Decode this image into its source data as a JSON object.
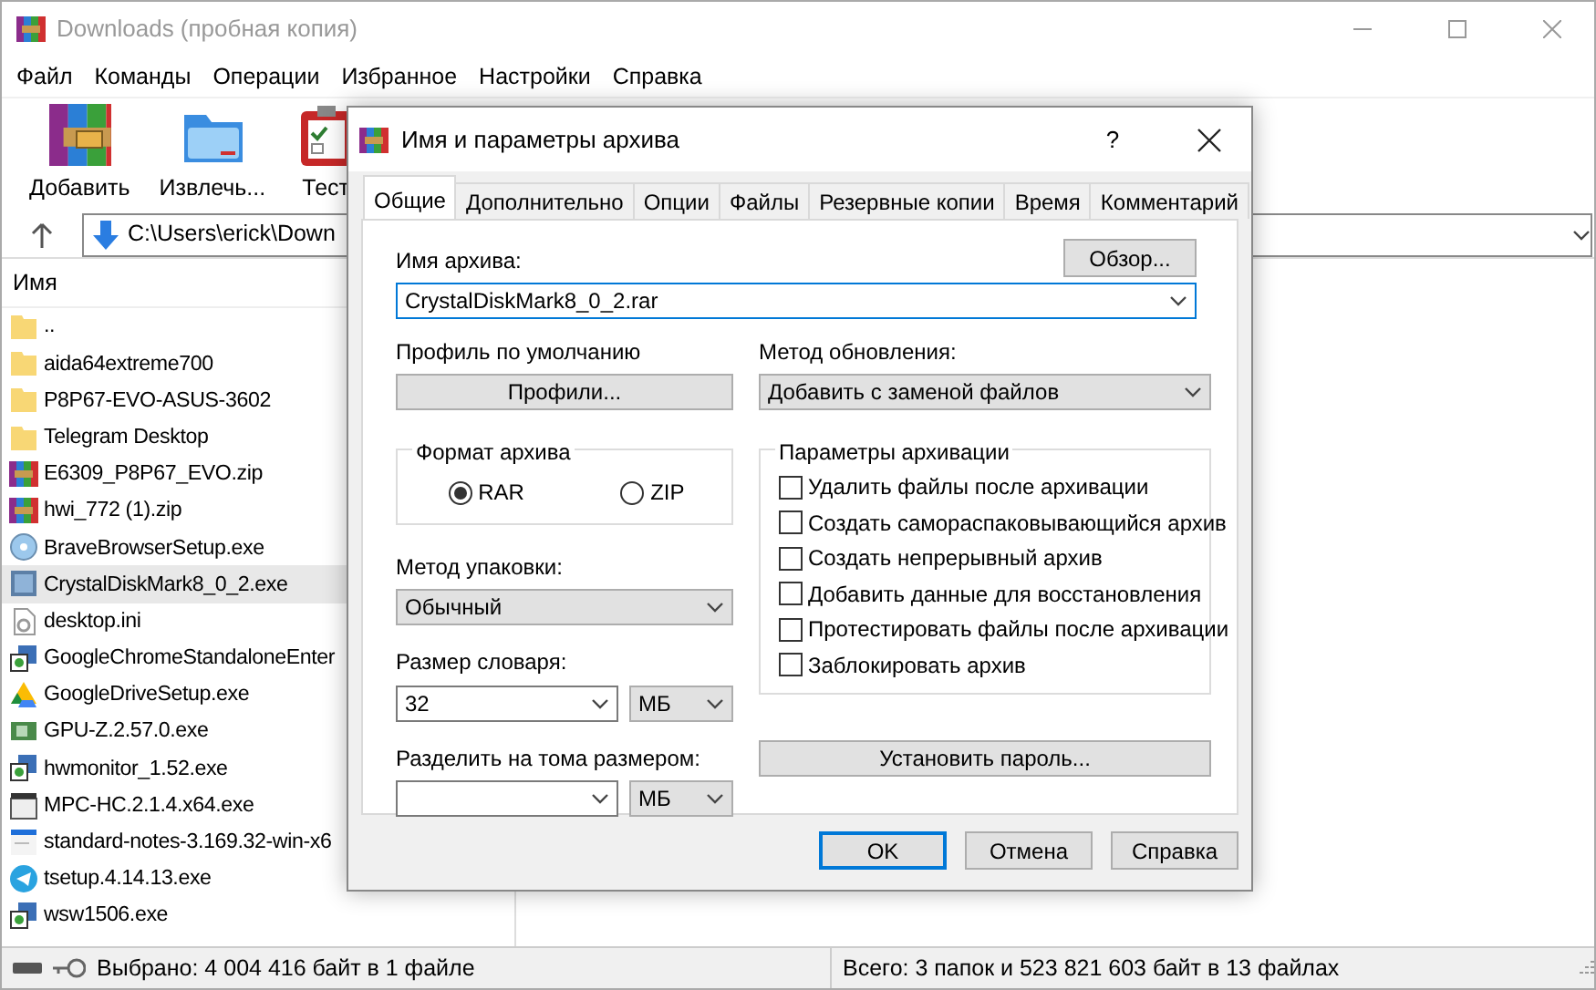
{
  "window": {
    "title": "Downloads (пробная копия)"
  },
  "menu": [
    "Файл",
    "Команды",
    "Операции",
    "Избранное",
    "Настройки",
    "Справка"
  ],
  "toolbar": [
    {
      "label": "Добавить",
      "kind": "archive"
    },
    {
      "label": "Извлечь...",
      "kind": "folder"
    },
    {
      "label": "Тест",
      "kind": "test"
    }
  ],
  "address": {
    "path": "C:\\Users\\erick\\Down"
  },
  "file_list": {
    "column": "Имя",
    "rows": [
      {
        "name": "..",
        "kind": "folder",
        "selected": false
      },
      {
        "name": "aida64extreme700",
        "kind": "folder",
        "selected": false
      },
      {
        "name": "P8P67-EVO-ASUS-3602",
        "kind": "folder",
        "selected": false
      },
      {
        "name": "Telegram Desktop",
        "kind": "folder",
        "selected": false
      },
      {
        "name": "E6309_P8P67_EVO.zip",
        "kind": "archive",
        "selected": false
      },
      {
        "name": "hwi_772 (1).zip",
        "kind": "archive",
        "selected": false
      },
      {
        "name": "BraveBrowserSetup.exe",
        "kind": "disc",
        "selected": false
      },
      {
        "name": "CrystalDiskMark8_0_2.exe",
        "kind": "app",
        "selected": true
      },
      {
        "name": "desktop.ini",
        "kind": "settings",
        "selected": false
      },
      {
        "name": "GoogleChromeStandaloneEnter",
        "kind": "setup",
        "selected": false
      },
      {
        "name": "GoogleDriveSetup.exe",
        "kind": "triangle",
        "selected": false
      },
      {
        "name": "GPU-Z.2.57.0.exe",
        "kind": "board",
        "selected": false
      },
      {
        "name": "hwmonitor_1.52.exe",
        "kind": "setup",
        "selected": false
      },
      {
        "name": "MPC-HC.2.1.4.x64.exe",
        "kind": "film",
        "selected": false
      },
      {
        "name": "standard-notes-3.169.32-win-x6",
        "kind": "doc",
        "selected": false
      },
      {
        "name": "tsetup.4.14.13.exe",
        "kind": "round",
        "selected": false
      },
      {
        "name": "wsw1506.exe",
        "kind": "setup",
        "selected": false
      }
    ]
  },
  "status_bar": {
    "left": "Выбрано: 4 004 416 байт в 1 файле",
    "right": "Всего: 3 папок и 523 821 603 байт в 13 файлах"
  },
  "dialog": {
    "title": "Имя и параметры архива",
    "help": "?",
    "tabs": [
      {
        "label": "Общие",
        "selected": true
      },
      {
        "label": "Дополнительно",
        "selected": false
      },
      {
        "label": "Опции",
        "selected": false
      },
      {
        "label": "Файлы",
        "selected": false
      },
      {
        "label": "Резервные копии",
        "selected": false
      },
      {
        "label": "Время",
        "selected": false
      },
      {
        "label": "Комментарий",
        "selected": false
      }
    ],
    "archive_name_label": "Имя архива:",
    "browse_button": "Обзор...",
    "archive_name": "CrystalDiskMark8_0_2.rar",
    "profile_label": "Профиль по умолчанию",
    "profiles_button": "Профили...",
    "update_label": "Метод обновления:",
    "update_value": "Добавить с заменой файлов",
    "format_group": {
      "title": "Формат архива",
      "options": [
        {
          "label": "RAR",
          "selected": true
        },
        {
          "label": "ZIP",
          "selected": false
        }
      ]
    },
    "method_label": "Метод упаковки:",
    "method_value": "Обычный",
    "dict_label": "Размер словаря:",
    "dict_value": "32",
    "dict_unit": "МБ",
    "split_label": "Разделить на тома размером:",
    "split_unit": "МБ",
    "options_group": {
      "title": "Параметры архивации",
      "items": [
        {
          "label": "Удалить файлы после архивации",
          "checked": false
        },
        {
          "label": "Создать самораспаковывающийся архив",
          "checked": false
        },
        {
          "label": "Создать непрерывный архив",
          "checked": false
        },
        {
          "label": "Добавить данные для восстановления",
          "checked": false
        },
        {
          "label": "Протестировать файлы после архивации",
          "checked": false
        },
        {
          "label": "Заблокировать архив",
          "checked": false
        }
      ]
    },
    "password_button": "Установить пароль...",
    "buttons": [
      {
        "label": "OK",
        "default": true
      },
      {
        "label": "Отмена",
        "default": false
      },
      {
        "label": "Справка",
        "default": false
      }
    ]
  }
}
